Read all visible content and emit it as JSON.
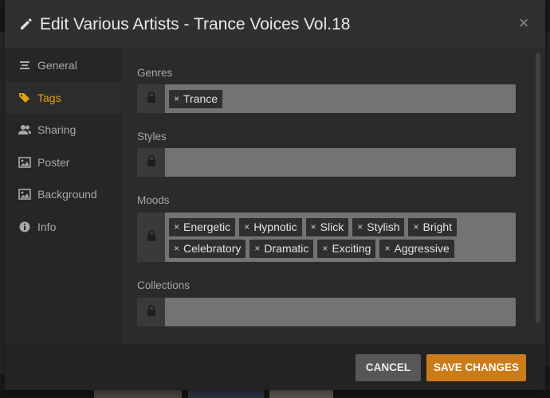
{
  "dialog": {
    "title": "Edit Various Artists - Trance Voices Vol.18",
    "close_glyph": "×"
  },
  "sidebar": {
    "items": [
      {
        "label": "General",
        "icon": "list-icon",
        "active": false
      },
      {
        "label": "Tags",
        "icon": "tag-icon",
        "active": true
      },
      {
        "label": "Sharing",
        "icon": "users-icon",
        "active": false
      },
      {
        "label": "Poster",
        "icon": "image-icon",
        "active": false
      },
      {
        "label": "Background",
        "icon": "image-icon",
        "active": false
      },
      {
        "label": "Info",
        "icon": "info-icon",
        "active": false
      }
    ]
  },
  "fields": {
    "genres": {
      "label": "Genres",
      "tags": [
        "Trance"
      ]
    },
    "styles": {
      "label": "Styles",
      "tags": []
    },
    "moods": {
      "label": "Moods",
      "tags": [
        "Energetic",
        "Hypnotic",
        "Slick",
        "Stylish",
        "Bright",
        "Celebratory",
        "Dramatic",
        "Exciting",
        "Aggressive"
      ]
    },
    "collections": {
      "label": "Collections",
      "tags": []
    }
  },
  "tag_remove_glyph": "×",
  "footer": {
    "cancel_label": "CANCEL",
    "save_label": "SAVE CHANGES"
  },
  "colors": {
    "accent": "#e5a00d",
    "save_button": "#cc7b19"
  }
}
